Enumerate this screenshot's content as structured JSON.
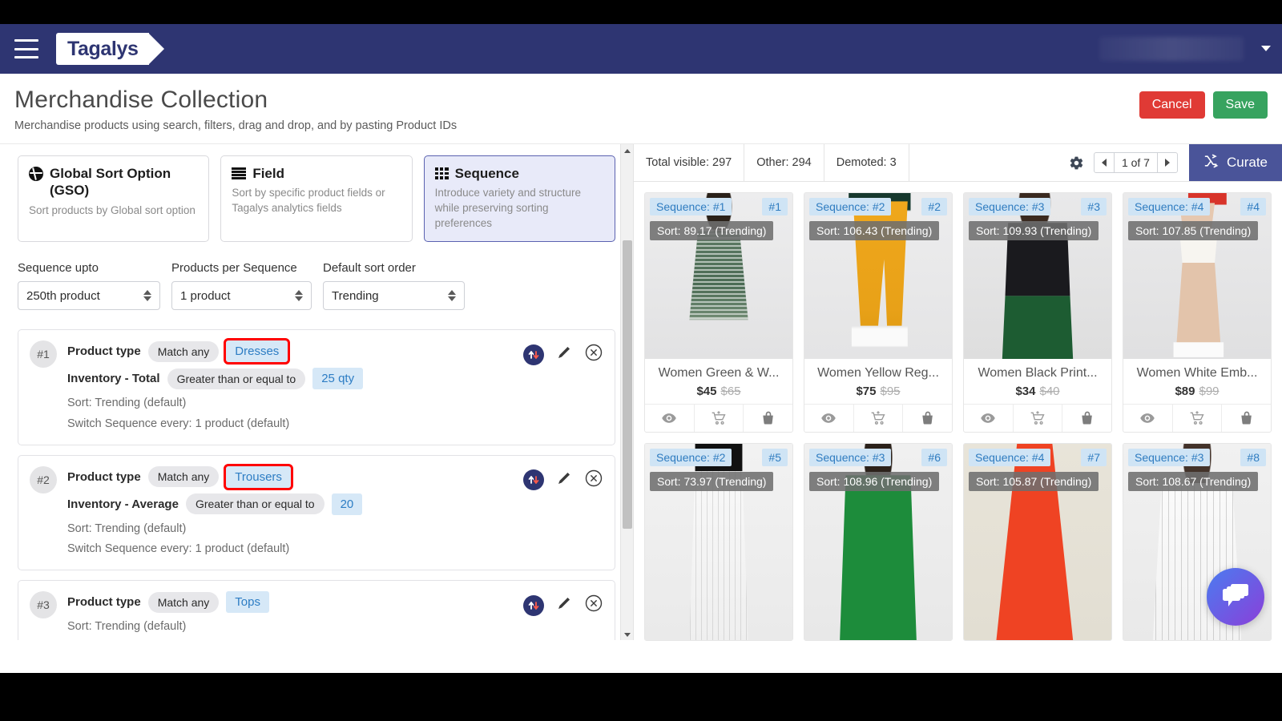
{
  "topbar": {
    "menu_icon": "hamburger-icon",
    "logo_text": "Tagalys",
    "user_caret_icon": "chevron-down-icon"
  },
  "header": {
    "title": "Merchandise Collection",
    "subtitle": "Merchandise products using search, filters, drag and drop, and by pasting Product IDs",
    "cancel_label": "Cancel",
    "save_label": "Save",
    "cancel_color": "#e03a35",
    "save_color": "#37a35f"
  },
  "sort_modes": [
    {
      "icon": "globe-icon",
      "title": "Global Sort Option (GSO)",
      "desc": "Sort products by Global sort option",
      "active": false
    },
    {
      "icon": "list-lines-icon",
      "title": "Field",
      "desc": "Sort by specific product fields or Tagalys analytics fields",
      "active": false
    },
    {
      "icon": "grid-icon",
      "title": "Sequence",
      "desc": "Introduce variety and structure while preserving sorting preferences",
      "active": true
    }
  ],
  "selects": [
    {
      "label": "Sequence upto",
      "value": "250th product"
    },
    {
      "label": "Products per Sequence",
      "value": "1 product"
    },
    {
      "label": "Default sort order",
      "value": "Trending"
    }
  ],
  "rules": [
    {
      "num": "#1",
      "line1_field": "Product type",
      "line1_op": "Match any",
      "line1_value": "Dresses",
      "line1_highlight": true,
      "line2_field": "Inventory - Total",
      "line2_op": "Greater than or equal to",
      "line2_value": "25 qty",
      "sort": "Sort: Trending (default)",
      "switch": "Switch Sequence every: 1 product (default)"
    },
    {
      "num": "#2",
      "line1_field": "Product type",
      "line1_op": "Match any",
      "line1_value": "Trousers",
      "line1_highlight": true,
      "line2_field": "Inventory - Average",
      "line2_op": "Greater than or equal to",
      "line2_value": "20",
      "sort": "Sort: Trending (default)",
      "switch": "Switch Sequence every: 1 product (default)"
    },
    {
      "num": "#3",
      "line1_field": "Product type",
      "line1_op": "Match any",
      "line1_value": "Tops",
      "line1_highlight": false,
      "line2_field": "",
      "line2_op": "",
      "line2_value": "",
      "sort": "Sort: Trending (default)",
      "switch": ""
    }
  ],
  "rule_actions": {
    "sort_icon": "sort-updown-icon",
    "edit_icon": "pencil-icon",
    "delete_icon": "close-circle-icon"
  },
  "stats": {
    "total_visible": "Total visible: 297",
    "other": "Other: 294",
    "demoted": "Demoted: 3",
    "gear_icon": "gear-icon",
    "page_text": "1 of 7",
    "prev_icon": "chevron-left-icon",
    "next_icon": "chevron-right-icon",
    "curate_label": "Curate",
    "curate_icon": "shuffle-icon",
    "curate_color": "#4a5499"
  },
  "products": [
    {
      "sequence": "Sequence: #1",
      "position": "#1",
      "sort": "Sort: 89.17 (Trending)",
      "name": "Women Green & W...",
      "price": "$45",
      "old_price": "$65"
    },
    {
      "sequence": "Sequence: #2",
      "position": "#2",
      "sort": "Sort: 106.43 (Trending)",
      "name": "Women Yellow Reg...",
      "price": "$75",
      "old_price": "$95"
    },
    {
      "sequence": "Sequence: #3",
      "position": "#3",
      "sort": "Sort: 109.93 (Trending)",
      "name": "Women Black Print...",
      "price": "$34",
      "old_price": "$40"
    },
    {
      "sequence": "Sequence: #4",
      "position": "#4",
      "sort": "Sort: 107.85 (Trending)",
      "name": "Women White Emb...",
      "price": "$89",
      "old_price": "$99"
    },
    {
      "sequence": "Sequence: #2",
      "position": "#5",
      "sort": "Sort: 73.97 (Trending)",
      "name": "",
      "price": "",
      "old_price": ""
    },
    {
      "sequence": "Sequence: #3",
      "position": "#6",
      "sort": "Sort: 108.96 (Trending)",
      "name": "",
      "price": "",
      "old_price": ""
    },
    {
      "sequence": "Sequence: #4",
      "position": "#7",
      "sort": "Sort: 105.87 (Trending)",
      "name": "",
      "price": "",
      "old_price": ""
    },
    {
      "sequence": "Sequence: #3",
      "position": "#8",
      "sort": "Sort: 108.67 (Trending)",
      "name": "",
      "price": "",
      "old_price": ""
    }
  ],
  "product_actions": {
    "preview_icon": "eye-icon",
    "add_to_cart_icon": "cart-plus-icon",
    "basket_icon": "basket-icon"
  },
  "chat": {
    "icon": "chat-bubbles-icon"
  }
}
